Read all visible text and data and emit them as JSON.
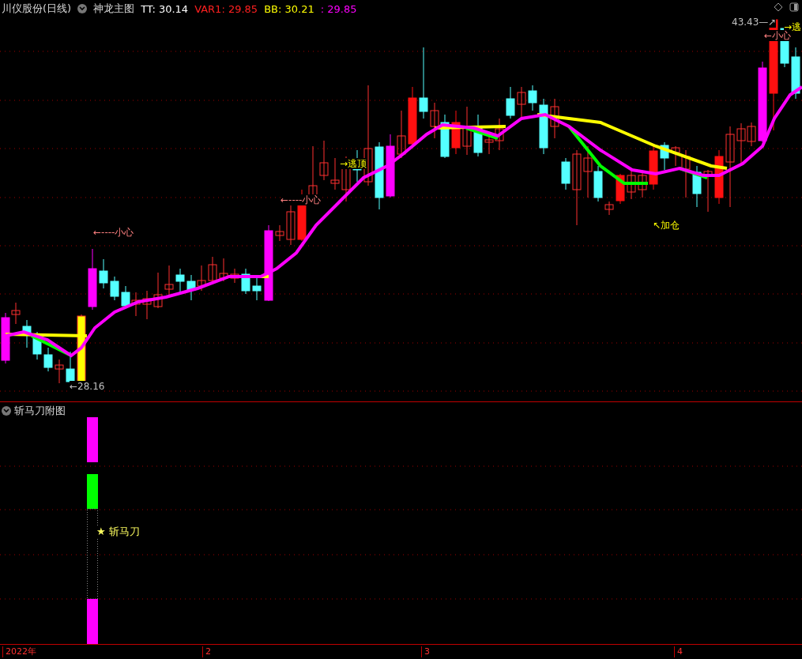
{
  "header": {
    "stock": "川仪股份(日线)",
    "indicator": "神龙主图",
    "readings": [
      {
        "text": "TT: 30.14",
        "color": "#ffffff"
      },
      {
        "text": "VAR1: 29.85",
        "color": "#ff2020"
      },
      {
        "text": "BB: 30.21",
        "color": "#ffff00"
      },
      {
        "text": ": 29.85",
        "color": "#ff00ff"
      }
    ]
  },
  "main_chart": {
    "annotations": [
      {
        "text": "←----小心",
        "color": "#ff8080"
      },
      {
        "text": "←----小心",
        "color": "#ff8080"
      },
      {
        "text": "→逃顶",
        "color": "#ffff00"
      },
      {
        "text": "↖加仓",
        "color": "#ffff00"
      },
      {
        "text": "←28.16",
        "color": "#c0c0c0"
      },
      {
        "text": "43.43—↗",
        "color": "#c0c0c0"
      },
      {
        "text": "→逃",
        "color": "#ffff00"
      },
      {
        "text": "←小心",
        "color": "#ff8080"
      }
    ]
  },
  "sub_chart": {
    "title": "斩马刀附图",
    "signal_label": "★ 斩马刀"
  },
  "time_axis": [
    "2022年",
    "2",
    "3",
    "4"
  ]
}
